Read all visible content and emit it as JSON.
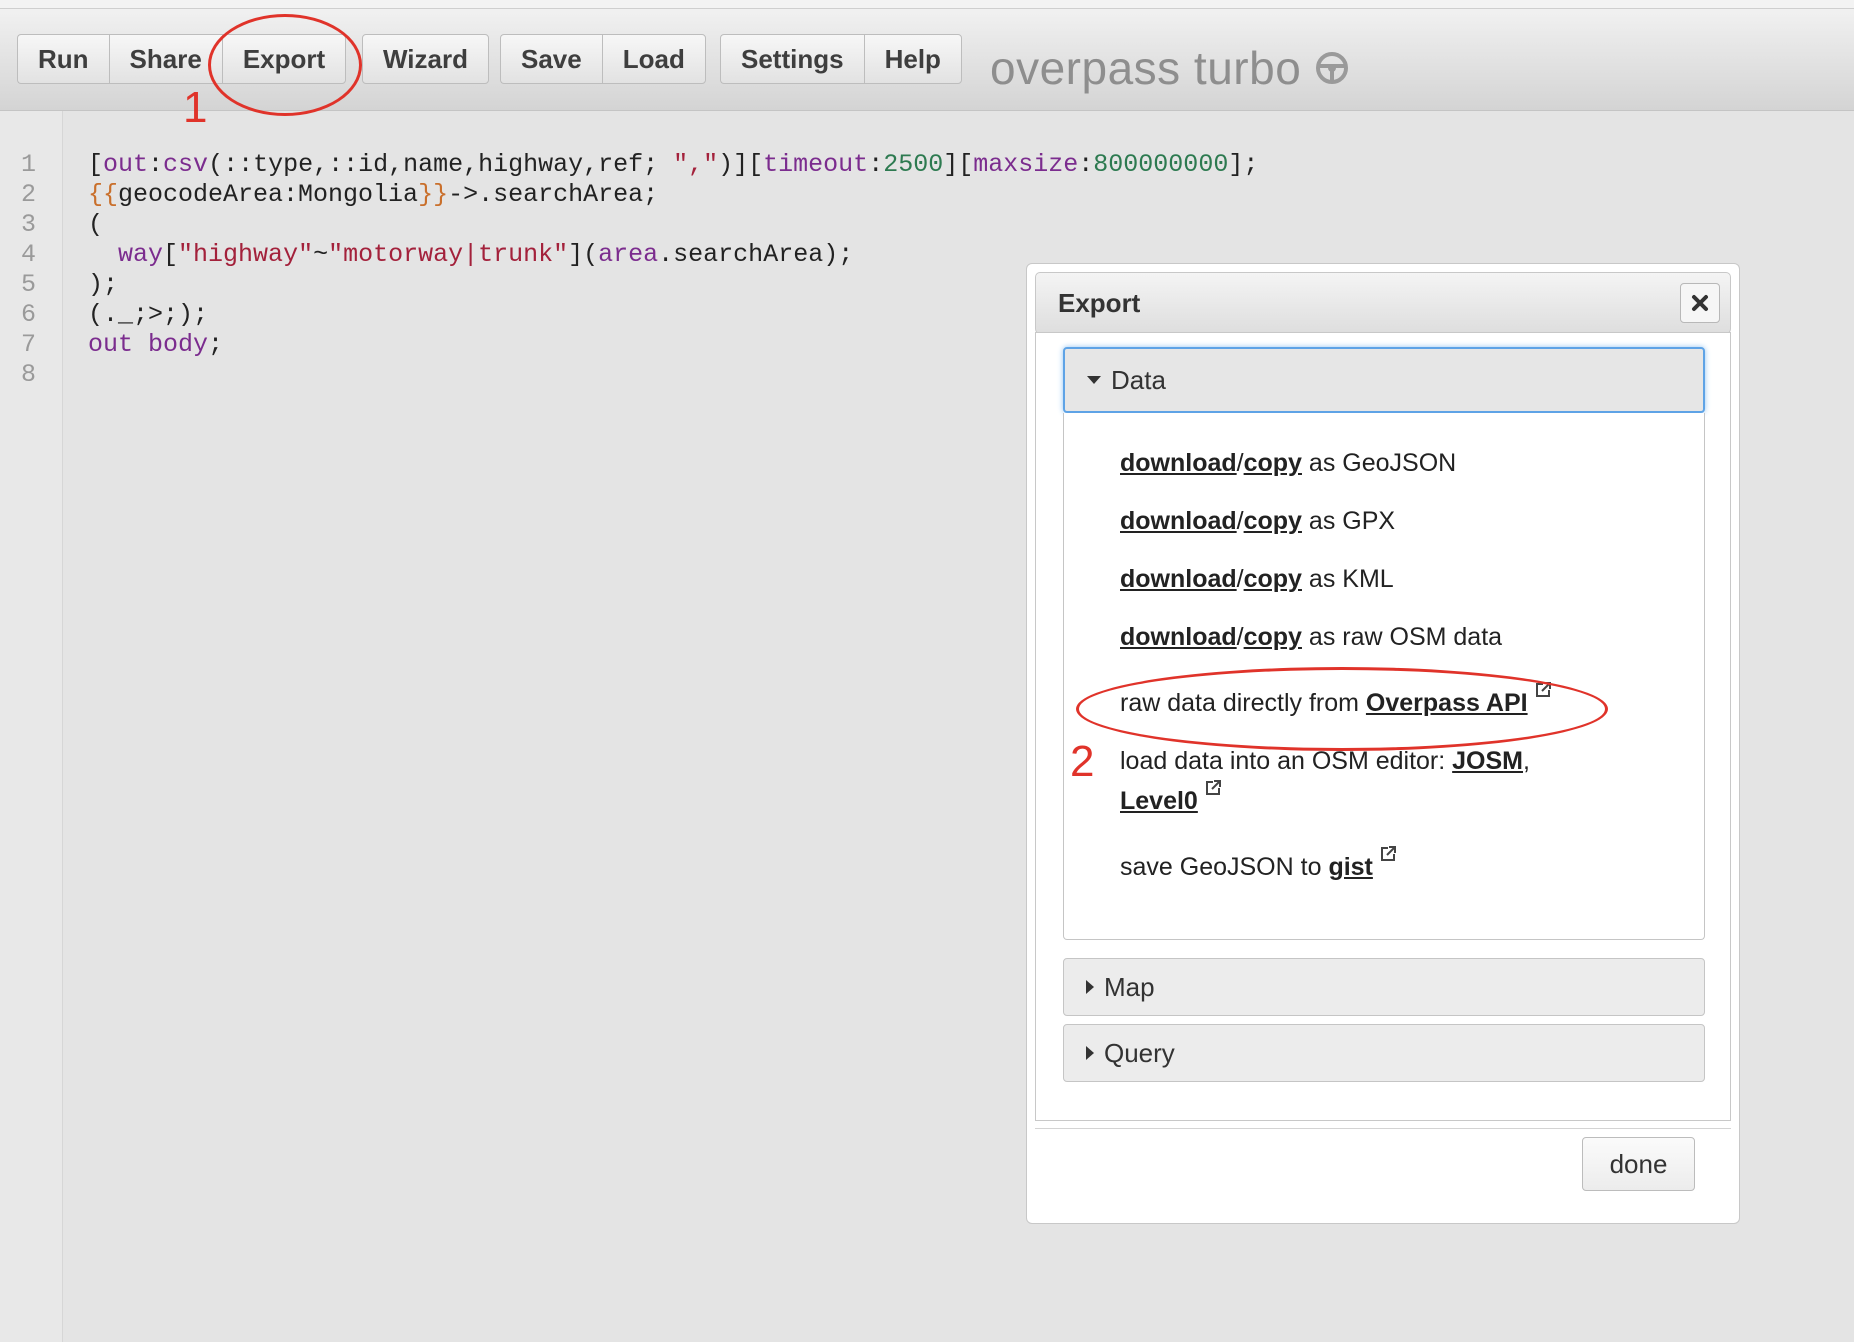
{
  "toolbar": {
    "group1": [
      "Run",
      "Share",
      "Export"
    ],
    "group2": [
      "Wizard"
    ],
    "group3": [
      "Save",
      "Load"
    ],
    "group4": [
      "Settings",
      "Help"
    ],
    "brand": "overpass turbo"
  },
  "annotations": {
    "step1": "1",
    "step2": "2"
  },
  "editor": {
    "line_numbers": [
      "1",
      "2",
      "3",
      "4",
      "5",
      "6",
      "7",
      "8"
    ],
    "lines": [
      "[out:csv(::type,::id,name,highway,ref; \",\")][timeout:2500][maxsize:800000000];",
      "{{geocodeArea:Mongolia}}->.searchArea;",
      "(",
      "  way[\"highway\"~\"motorway|trunk\"](area.searchArea);",
      ");",
      "(._;>;);",
      "out body;",
      ""
    ]
  },
  "dialog": {
    "title": "Export",
    "sections": {
      "data": "Data",
      "map": "Map",
      "query": "Query"
    },
    "download": "download",
    "copy": "copy",
    "slash": "/",
    "as_geojson": " as GeoJSON",
    "as_gpx": " as GPX",
    "as_kml": " as KML",
    "as_raw_osm": " as raw OSM data",
    "raw_prefix": "raw data directly from ",
    "overpass_api": "Overpass API",
    "editor_prefix": "load data into an OSM editor: ",
    "josm": "JOSM",
    "comma": ",",
    "level0": "Level0",
    "gist_prefix": "save GeoJSON to ",
    "gist": "gist",
    "done": "done"
  },
  "colors": {
    "annotation": "#e0332a",
    "focus": "#5ea3e6"
  },
  "icons": [
    "close-icon",
    "external-link-icon",
    "steering-wheel-icon",
    "caret-down-icon",
    "caret-right-icon"
  ]
}
